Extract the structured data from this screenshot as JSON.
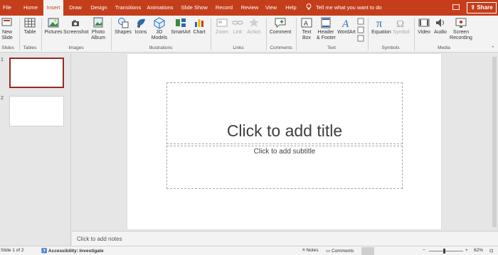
{
  "tabs": [
    "File",
    "Home",
    "Insert",
    "Draw",
    "Design",
    "Transitions",
    "Animations",
    "Slide Show",
    "Record",
    "Review",
    "View",
    "Help"
  ],
  "active_tab": "Insert",
  "tell_me": "Tell me what you want to do",
  "share": "Share",
  "ribbon": {
    "new_slide": "New\nSlide",
    "table": "Table",
    "pictures": "Pictures",
    "screenshot": "Screenshot",
    "photo_album": "Photo\nAlbum",
    "shapes": "Shapes",
    "icons": "Icons",
    "models_3d": "3D\nModels",
    "smartart": "SmartArt",
    "chart": "Chart",
    "zoom": "Zoom",
    "link": "Link",
    "action": "Action",
    "comment": "Comment",
    "text_box": "Text\nBox",
    "header_footer": "Header\n& Footer",
    "wordart": "WordArt",
    "equation": "Equation",
    "symbol": "Symbol",
    "video": "Video",
    "audio": "Audio",
    "screen_recording": "Screen\nRecording"
  },
  "groups": [
    "Slides",
    "Tables",
    "Images",
    "Illustrations",
    "Links",
    "Comments",
    "Text",
    "Symbols",
    "Media"
  ],
  "thumbnails": [
    {
      "num": "1"
    },
    {
      "num": "2"
    }
  ],
  "slide": {
    "title_placeholder": "Click to add title",
    "subtitle_placeholder": "Click to add subtitle"
  },
  "notes_placeholder": "Click to add notes",
  "status": {
    "slide_info": "Slide 1 of 2",
    "accessibility": "Accessibility: Investigate",
    "notes": "Notes",
    "comments": "Comments",
    "zoom": "62%"
  },
  "colors": {
    "accent": "#c43e1c",
    "ribbon_bg": "#f3f3f3",
    "selected_thumb": "#9a2a1d"
  }
}
